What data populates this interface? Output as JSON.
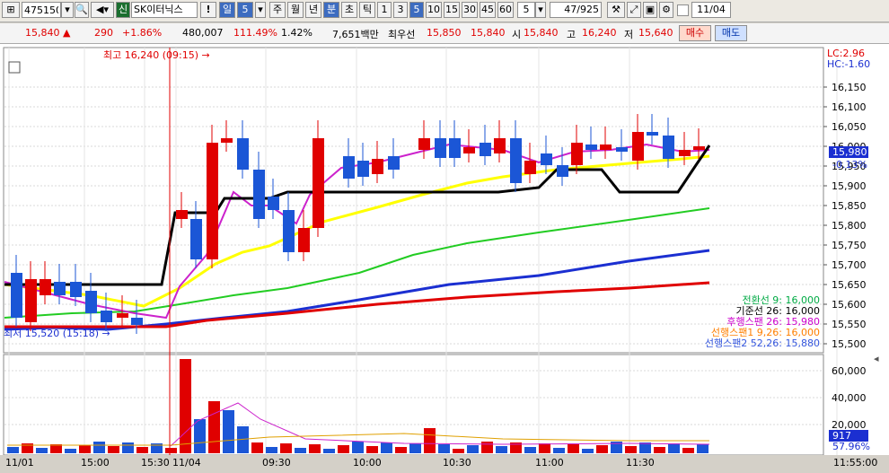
{
  "toolbar": {
    "code": "475150",
    "market_badge": "신",
    "stock_name": "SK이터닉스",
    "warn": "!",
    "period_day": "일",
    "period_num": "5",
    "periods": [
      "주",
      "월",
      "년",
      "분",
      "초",
      "틱"
    ],
    "minutes": [
      "1",
      "3",
      "5",
      "10",
      "15",
      "30",
      "45",
      "60"
    ],
    "interval_value": "5",
    "count": "47",
    "count_total": "/925",
    "date": "11/04"
  },
  "quote": {
    "price": "15,840",
    "arrow": "▲",
    "change": "290",
    "change_pct": "+1.86%",
    "volume": "480,007",
    "vol_ratio": "111.49%",
    "turnover": "1.42%",
    "amount": "7,651백만",
    "best_label": "최우선",
    "best_ask": "15,850",
    "best_bid": "15,840",
    "open_label": "시",
    "open": "15,840",
    "high_label": "고",
    "high": "16,240",
    "low_label": "저",
    "low": "15,640",
    "buy": "매수",
    "sell": "매도"
  },
  "chart_data": {
    "type": "candlestick",
    "price_axis": {
      "ticks": [
        "16,150",
        "16,100",
        "16,050",
        "16,000",
        "15,950",
        "15,900",
        "15,850",
        "15,800",
        "15,750",
        "15,700",
        "15,650",
        "15,600",
        "15,550",
        "15,500"
      ]
    },
    "volume_axis": {
      "ticks": [
        "60,000",
        "40,000",
        "20,000"
      ]
    },
    "time_labels": [
      "11/01",
      "15:00",
      "15:30",
      "11/04",
      "09:30",
      "10:00",
      "10:30",
      "11:00",
      "11:30",
      "11:55:00"
    ],
    "current_price": "15,980",
    "current_pct": "-0.13%",
    "current_volume": "917",
    "current_volume_pct": "57.96%",
    "lc": "LC:2.96",
    "hc": "HC:-1.60",
    "high_note": "최고 16,240 (09:15) →",
    "low_note": "최저 15,520 (15:18) →",
    "legend": [
      {
        "text": "전환선 9: 16,000",
        "color": "#00aa44"
      },
      {
        "text": "기준선 26: 16,000",
        "color": "#000000"
      },
      {
        "text": "후행스팬 26: 15,980",
        "color": "#cc00cc"
      },
      {
        "text": "선행스팬1 9,26: 16,000",
        "color": "#ff7f00"
      },
      {
        "text": "선행스팬2 52,26: 15,880",
        "color": "#3355dd"
      }
    ]
  }
}
